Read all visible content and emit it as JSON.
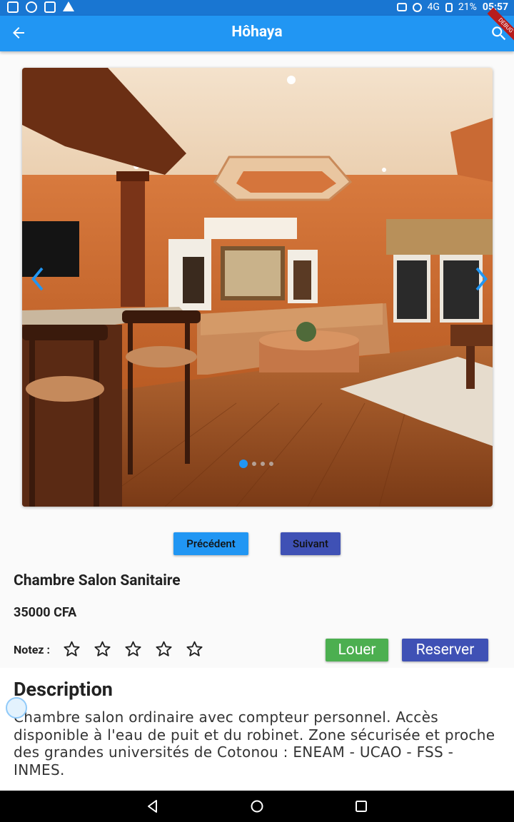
{
  "status_bar": {
    "network": "4G",
    "battery": "21%",
    "time": "05:57"
  },
  "app_bar": {
    "title": "Hôhaya",
    "debug_banner": "DEBUG"
  },
  "carousel": {
    "slide_count": 4,
    "active_index": 0
  },
  "buttons": {
    "previous": "Précédent",
    "next": "Suivant",
    "rent": "Louer",
    "reserve": "Reserver"
  },
  "listing": {
    "title": "Chambre Salon Sanitaire",
    "price": "35000 CFA",
    "rating_label": "Notez :",
    "rating": 0,
    "rating_max": 5
  },
  "description": {
    "heading": "Description",
    "text": "Chambre salon ordinaire avec compteur personnel. Accès disponible à l'eau de puit et du robinet. Zone sécurisée et proche des grandes universités de Cotonou : ENEAM - UCAO - FSS - INMES."
  },
  "colors": {
    "primary": "#2196f3",
    "status_bar": "#1976d2",
    "indigo": "#3f51b5",
    "green": "#4caf50"
  }
}
